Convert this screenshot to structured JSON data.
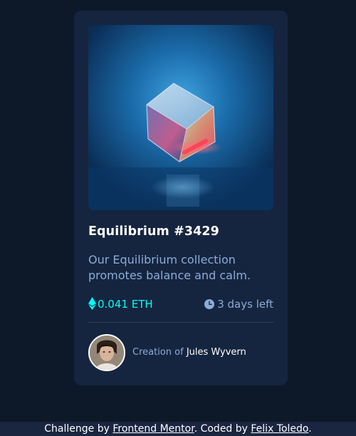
{
  "card": {
    "image_alt": "Equilibrium",
    "title": "Equilibrium #3429",
    "description": "Our Equilibrium collection promotes balance and calm.",
    "price": "0.041 ETH",
    "price_icon": "ethereum-icon",
    "time_left": "3 days left",
    "time_icon": "clock-icon",
    "creator_prefix": "Creation of",
    "creator_name": "Jules Wyvern"
  },
  "attribution": {
    "text_1": "Challenge by ",
    "link_1": "Frontend Mentor",
    "text_2": ". Coded by ",
    "link_2": "Felix Toledo",
    "text_3": "."
  },
  "colors": {
    "page_background": "#0d1829",
    "card_background": "#15253f",
    "accent_cyan": "#00fff7",
    "soft_blue": "#8bacd9",
    "divider": "#2e405a",
    "white": "#ffffff"
  }
}
